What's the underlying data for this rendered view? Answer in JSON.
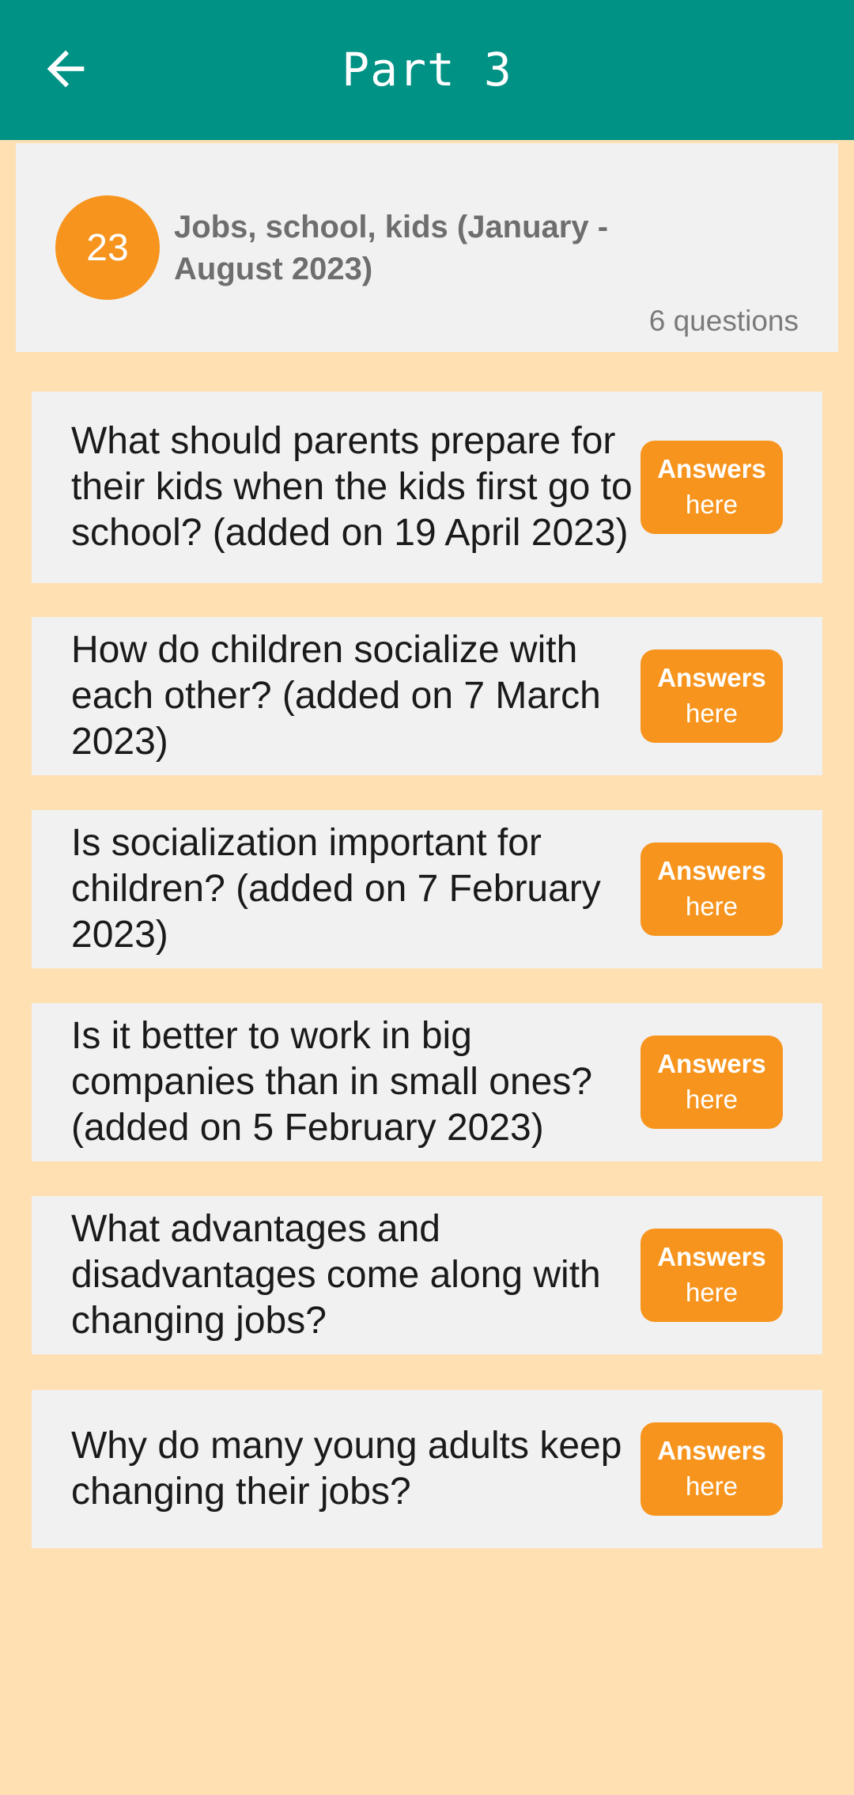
{
  "appbar": {
    "title": "Part 3",
    "back_icon": "arrow-left-icon"
  },
  "topic": {
    "number": "23",
    "title": "Jobs, school, kids (January - August 2023)",
    "count": "6 questions"
  },
  "questions": [
    {
      "text": "What should parents prepare for their kids when the kids first go to school? (added on 19 April 2023)",
      "btn_line1": "Answers",
      "btn_line2": "here"
    },
    {
      "text": "How do children socialize with each other? (added on 7 March 2023)",
      "btn_line1": "Answers",
      "btn_line2": "here"
    },
    {
      "text": "Is socialization important for children? (added on 7 February 2023)",
      "btn_line1": "Answers",
      "btn_line2": "here"
    },
    {
      "text": "Is it better to work in big companies than in small ones? (added on 5 February 2023)",
      "btn_line1": "Answers",
      "btn_line2": "here"
    },
    {
      "text": "What advantages and disadvantages come along with changing jobs?",
      "btn_line1": "Answers",
      "btn_line2": "here"
    },
    {
      "text": "Why do many young adults keep changing their jobs?",
      "btn_line1": "Answers",
      "btn_line2": "here"
    }
  ],
  "colors": {
    "appbar": "#009285",
    "background": "#FFE0B3",
    "card": "#F1F1F1",
    "accent": "#F7941D"
  }
}
